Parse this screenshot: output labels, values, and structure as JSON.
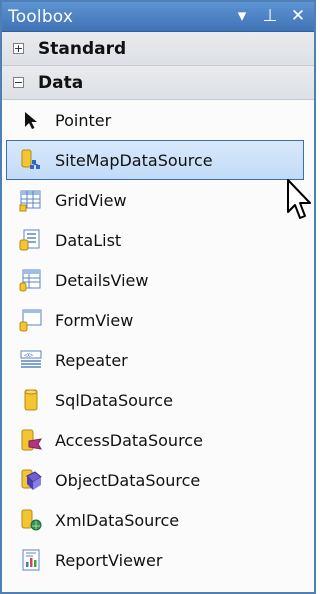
{
  "window": {
    "title": "Toolbox"
  },
  "title_controls": [
    "▾",
    "⊥",
    "✕"
  ],
  "categories": {
    "standard": {
      "label": "Standard",
      "expander": "+"
    },
    "data": {
      "label": "Data",
      "expander": "−"
    }
  },
  "items": [
    {
      "label": "Pointer",
      "icon": "pointer-icon"
    },
    {
      "label": "SiteMapDataSource",
      "icon": "sitemap-datasource-icon",
      "selected": true
    },
    {
      "label": "GridView",
      "icon": "gridview-icon"
    },
    {
      "label": "DataList",
      "icon": "datalist-icon"
    },
    {
      "label": "DetailsView",
      "icon": "detailsview-icon"
    },
    {
      "label": "FormView",
      "icon": "formview-icon"
    },
    {
      "label": "Repeater",
      "icon": "repeater-icon"
    },
    {
      "label": "SqlDataSource",
      "icon": "sql-datasource-icon"
    },
    {
      "label": "AccessDataSource",
      "icon": "access-datasource-icon"
    },
    {
      "label": "ObjectDataSource",
      "icon": "object-datasource-icon"
    },
    {
      "label": "XmlDataSource",
      "icon": "xml-datasource-icon"
    },
    {
      "label": "ReportViewer",
      "icon": "reportviewer-icon"
    }
  ]
}
